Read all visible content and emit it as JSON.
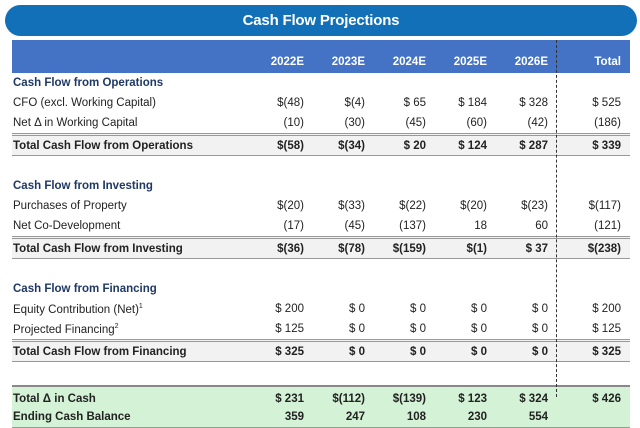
{
  "title": "Cash Flow Projections",
  "columns": [
    "2022E",
    "2023E",
    "2024E",
    "2025E",
    "2026E",
    "Total"
  ],
  "sections": [
    {
      "heading": "Cash Flow from Operations",
      "rows": [
        {
          "label": "CFO (excl. Working Capital)",
          "values": [
            "$(48)",
            "$(4)",
            "$ 65",
            "$ 184",
            "$ 328",
            "$ 525"
          ]
        },
        {
          "label": "Net  Δ in Working Capital",
          "values": [
            "(10)",
            "(30)",
            "(45)",
            "(60)",
            "(42)",
            "(186)"
          ]
        }
      ],
      "total": {
        "label": "Total Cash Flow from Operations",
        "values": [
          "$(58)",
          "$(34)",
          "$ 20",
          "$ 124",
          "$ 287",
          "$ 339"
        ]
      }
    },
    {
      "heading": "Cash Flow from Investing",
      "rows": [
        {
          "label": "Purchases of Property",
          "values": [
            "$(20)",
            "$(33)",
            "$(22)",
            "$(20)",
            "$(23)",
            "$(117)"
          ]
        },
        {
          "label": "Net Co-Development",
          "values": [
            "(17)",
            "(45)",
            "(137)",
            "18",
            "60",
            "(121)"
          ]
        }
      ],
      "total": {
        "label": "Total Cash Flow from Investing",
        "values": [
          "$(36)",
          "$(78)",
          "$(159)",
          "$(1)",
          "$ 37",
          "$(238)"
        ]
      }
    },
    {
      "heading": "Cash Flow from Financing",
      "rows": [
        {
          "label": "Equity Contribution (Net)",
          "sup": "1",
          "values": [
            "$ 200",
            "$ 0",
            "$ 0",
            "$ 0",
            "$ 0",
            "$ 200"
          ]
        },
        {
          "label": "Projected Financing",
          "sup": "2",
          "values": [
            "$ 125",
            "$ 0",
            "$ 0",
            "$ 0",
            "$ 0",
            "$ 125"
          ]
        }
      ],
      "total": {
        "label": "Total Cash Flow from Financing",
        "values": [
          "$ 325",
          "$ 0",
          "$ 0",
          "$ 0",
          "$ 0",
          "$ 325"
        ]
      }
    }
  ],
  "summary": [
    {
      "label": "Total Δ in Cash",
      "values": [
        "$ 231",
        "$(112)",
        "$(139)",
        "$ 123",
        "$ 324",
        "$ 426"
      ]
    },
    {
      "label": "Ending Cash Balance",
      "values": [
        "359",
        "247",
        "108",
        "230",
        "554",
        ""
      ]
    }
  ]
}
